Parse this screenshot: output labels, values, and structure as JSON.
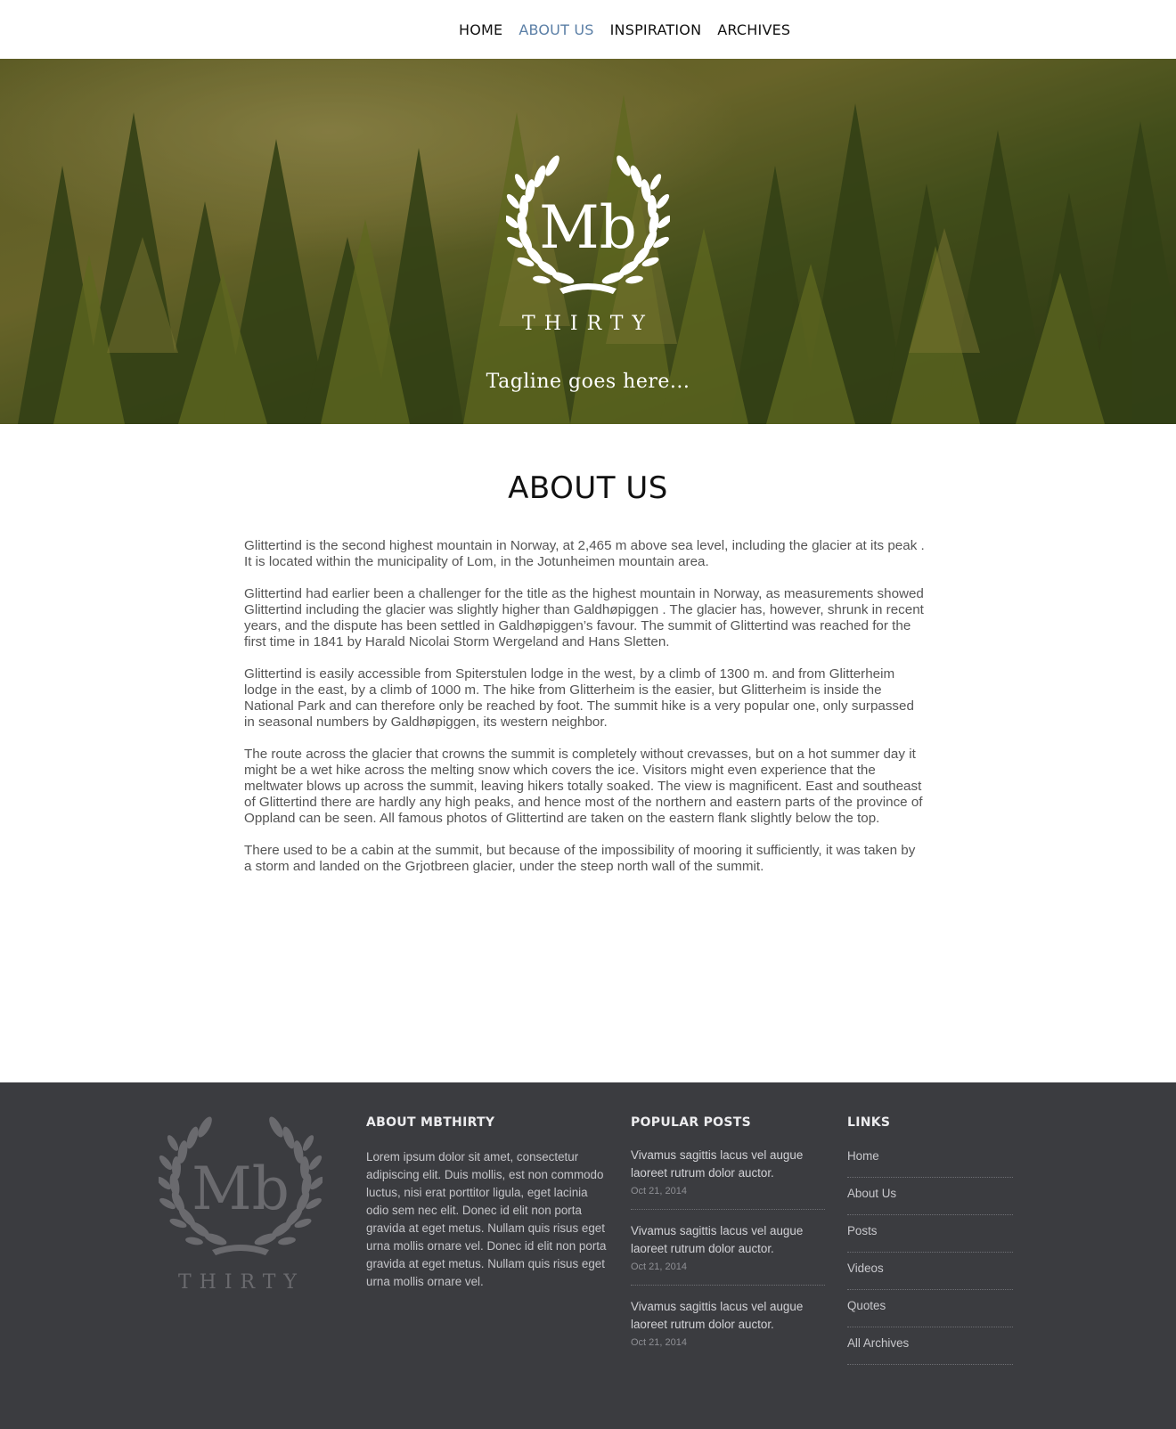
{
  "nav": {
    "items": [
      {
        "label": "HOME",
        "active": false
      },
      {
        "label": "ABOUT US",
        "active": true
      },
      {
        "label": "INSPIRATION",
        "active": false
      },
      {
        "label": "ARCHIVES",
        "active": false
      }
    ]
  },
  "hero": {
    "logo_monogram": "Mb",
    "brand": "THIRTY",
    "tagline": "Tagline goes here..."
  },
  "main": {
    "title": "ABOUT US",
    "paragraphs": [
      "Glittertind is the second highest mountain in Norway, at 2,465 m above sea level, including the glacier at its peak . It is located within the municipality of Lom, in the Jotunheimen mountain area.",
      "Glittertind had earlier been a challenger for the title as the highest mountain in Norway, as measurements showed Glittertind including the glacier was slightly higher than Galdhøpiggen . The glacier has, however, shrunk in recent years, and the dispute has been settled in Galdhøpiggen’s favour. The summit of Glittertind was reached for the first time in 1841 by Harald Nicolai Storm Wergeland and Hans Sletten.",
      "Glittertind is easily accessible from Spiterstulen lodge in the west, by a climb of 1300 m. and from Glitterheim lodge in the east, by a climb of 1000 m. The hike from Glitterheim is the easier, but Glitterheim is inside the National Park and can therefore only be reached by foot. The summit hike is a very popular one, only surpassed in seasonal numbers by Galdhøpiggen, its western neighbor.",
      "The route across the glacier that crowns the summit is completely without crevasses, but on a hot summer day it might be a wet hike across the melting snow which covers the ice. Visitors might even experience that the meltwater blows up across the summit, leaving hikers totally soaked. The view is magnificent. East and southeast of Glittertind there are hardly any high peaks, and hence most of the northern and eastern parts of the province of Oppland can be seen. All famous photos of Glittertind are taken on the eastern flank slightly below the top.",
      "There used to be a cabin at the summit, but because of the impossibility of mooring it sufficiently, it was taken by a storm and landed on the Grjotbreen glacier, under the steep north wall of the summit."
    ]
  },
  "footer": {
    "logo_monogram": "Mb",
    "brand": "THIRTY",
    "about": {
      "heading": "ABOUT MBTHIRTY",
      "text": "Lorem ipsum dolor sit amet, consectetur adipiscing elit. Duis mollis, est non commodo luctus, nisi erat porttitor ligula, eget lacinia odio sem nec elit. Donec id elit non porta gravida at eget metus. Nullam quis risus eget urna mollis ornare vel. Donec id elit non porta gravida at eget metus. Nullam quis risus eget urna mollis ornare vel."
    },
    "popular": {
      "heading": "POPULAR POSTS",
      "posts": [
        {
          "title": "Vivamus sagittis lacus vel augue laoreet rutrum dolor auctor.",
          "date": "Oct 21, 2014"
        },
        {
          "title": "Vivamus sagittis lacus vel augue laoreet rutrum dolor auctor.",
          "date": "Oct 21, 2014"
        },
        {
          "title": "Vivamus sagittis lacus vel augue laoreet rutrum dolor auctor.",
          "date": "Oct 21, 2014"
        }
      ]
    },
    "links": {
      "heading": "LINKS",
      "items": [
        "Home",
        "About Us",
        "Posts",
        "Videos",
        "Quotes",
        "All Archives"
      ]
    }
  },
  "colors": {
    "nav_active": "#5b7fa6",
    "footer_bg": "#3b3c40",
    "body_text": "#555555"
  }
}
